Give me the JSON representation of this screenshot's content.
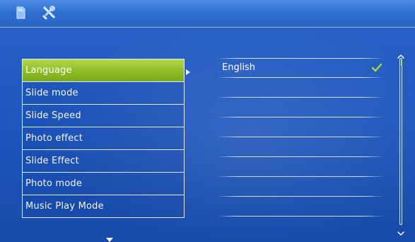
{
  "menu": {
    "items": [
      {
        "label": "Language",
        "selected": true
      },
      {
        "label": "Slide mode",
        "selected": false
      },
      {
        "label": "Slide Speed",
        "selected": false
      },
      {
        "label": "Photo effect",
        "selected": false
      },
      {
        "label": "Slide Effect",
        "selected": false
      },
      {
        "label": "Photo mode",
        "selected": false
      },
      {
        "label": "Music Play Mode",
        "selected": false
      }
    ]
  },
  "options": {
    "items": [
      {
        "label": "English",
        "checked": true
      },
      {
        "label": "",
        "checked": false
      },
      {
        "label": "",
        "checked": false
      },
      {
        "label": "",
        "checked": false
      },
      {
        "label": "",
        "checked": false
      },
      {
        "label": "",
        "checked": false
      },
      {
        "label": "",
        "checked": false
      },
      {
        "label": "",
        "checked": false
      }
    ]
  },
  "scrollbar": {
    "position_fraction": 0,
    "visible_fraction": 0.04
  },
  "icons": {
    "top_left_1": "memory-card-icon",
    "top_left_2": "tools-icon",
    "right_nav": "chevron-right-icon",
    "down_nav": "chevron-down-icon",
    "check": "check-icon",
    "scroll_up": "scroll-up-icon",
    "scroll_down": "scroll-down-icon"
  },
  "colors": {
    "background": "#1f56bd",
    "topbar": "#2f6fd0",
    "selected_item": "#8fbd28",
    "text": "#ffffff",
    "scroll_thumb": "#a7dd3c"
  }
}
